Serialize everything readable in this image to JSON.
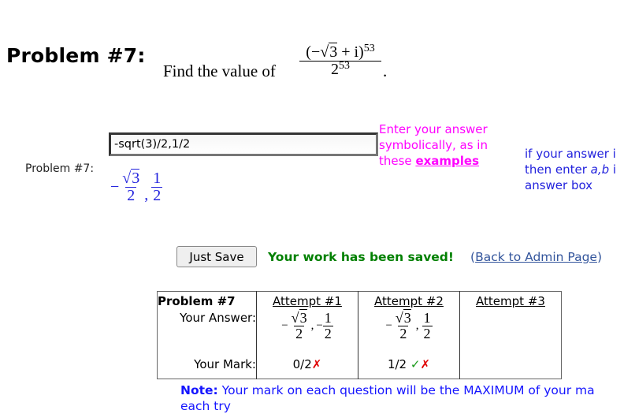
{
  "problem": {
    "title": "Problem #7:",
    "question_prefix": "Find the value of",
    "expression": {
      "numerator_base": "(−√3 + i)",
      "numerator_sqrt_arg": "3",
      "numerator_open": "(−",
      "numerator_close": " + i)",
      "numerator_exponent": "53",
      "denominator_base": "2",
      "denominator_exponent": "53"
    },
    "period": "."
  },
  "answer": {
    "label": "Problem #7:",
    "input_value": "-sqrt(3)/2,1/2",
    "preview": {
      "term1_sign": "−",
      "term1_sqrt_arg": "3",
      "term1_den": "2",
      "separator": ",",
      "term2_num": "1",
      "term2_den": "2"
    }
  },
  "hint": {
    "line1": "Enter your answer",
    "line2": "symbolically, as in",
    "line3_prefix": "these ",
    "examples_link": "examples"
  },
  "hint2": {
    "line1": "if your answer i",
    "line2_prefix": "then enter ",
    "line2_var": "a,b",
    "line2_suffix": " i",
    "line3": "answer box"
  },
  "actions": {
    "save_button": "Just Save",
    "saved_message": "Your work has been saved!",
    "admin_link_open": "(",
    "admin_link": "Back to Admin Page",
    "admin_link_close": ")"
  },
  "attempts_table": {
    "header": "Problem #7",
    "answer_label": "Your Answer:",
    "mark_label": "Your Mark:",
    "attempts": [
      {
        "label": "Attempt #1",
        "answer": {
          "sign1": "−",
          "sqrt_arg": "3",
          "den1": "2",
          "sep": ",",
          "sign2": "−",
          "num2": "1",
          "den2": "2"
        },
        "mark": "0/2",
        "status_icons": [
          "cross"
        ]
      },
      {
        "label": "Attempt #2",
        "answer": {
          "sign1": "−",
          "sqrt_arg": "3",
          "den1": "2",
          "sep": ",",
          "sign2": "",
          "num2": "1",
          "den2": "2"
        },
        "mark": "1/2",
        "status_icons": [
          "check",
          "cross"
        ]
      },
      {
        "label": "Attempt #3",
        "answer": null,
        "mark": ""
      }
    ],
    "icons": {
      "check": "✓",
      "cross": "✗"
    }
  },
  "note": {
    "label": "Note:",
    "text": " Your mark on each question will be the MAXIMUM of your ma",
    "line2": "each try"
  }
}
